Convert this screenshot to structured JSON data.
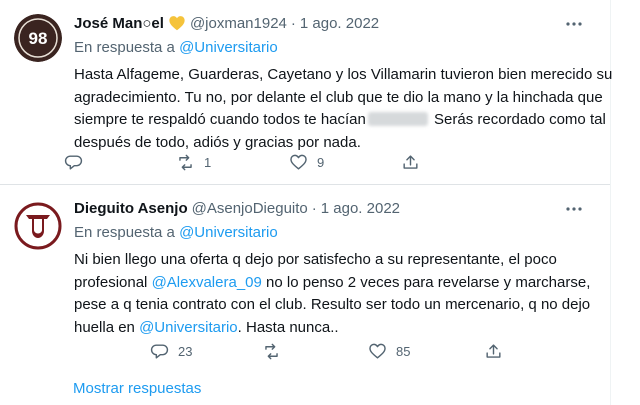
{
  "tweets": [
    {
      "name": "José Man○el",
      "handle": "@joxman1924",
      "date": "1 ago. 2022",
      "reply_prefix": "En respuesta a ",
      "reply_mention": "@Universitario",
      "body_before_blur": "Hasta Alfageme, Guarderas, Cayetano y los Villamarin tuvieron bien merecido su agradecimiento. Tu no, por delante el club que te dio la mano y la hinchada que siempre te respaldó cuando todos te hacían",
      "body_after_blur": " Serás recordado como tal después de todo, adiós y gracias por nada.",
      "counts": {
        "reply": "",
        "retweet": "1",
        "like": "9",
        "share": ""
      }
    },
    {
      "name": "Dieguito Asenjo",
      "handle": "@AsenjoDieguito",
      "date": "1 ago. 2022",
      "reply_prefix": "En respuesta a ",
      "reply_mention": "@Universitario",
      "body_1": "Ni bien llego una oferta q dejo por satisfecho a su representante, el poco profesional ",
      "body_mention_1": "@Alexvalera_09",
      "body_2": " no lo penso 2 veces para revelarse y marcharse, pese a q tenia contrato con el club. Resulto ser todo un mercenario, q no dejo huella en ",
      "body_mention_2": "@Universitario",
      "body_3": ". Hasta nunca..",
      "counts": {
        "reply": "23",
        "retweet": "",
        "like": "85",
        "share": ""
      }
    }
  ],
  "avatar1_text": "98",
  "show_replies": "Mostrar respuestas",
  "colors": {
    "accent": "#1d9bf0",
    "muted": "#536471",
    "text": "#0f1419",
    "heart_badge": "#f5c33b",
    "avatar1_bg": "#3a2420",
    "avatar2_maroon": "#7a1a1e"
  }
}
